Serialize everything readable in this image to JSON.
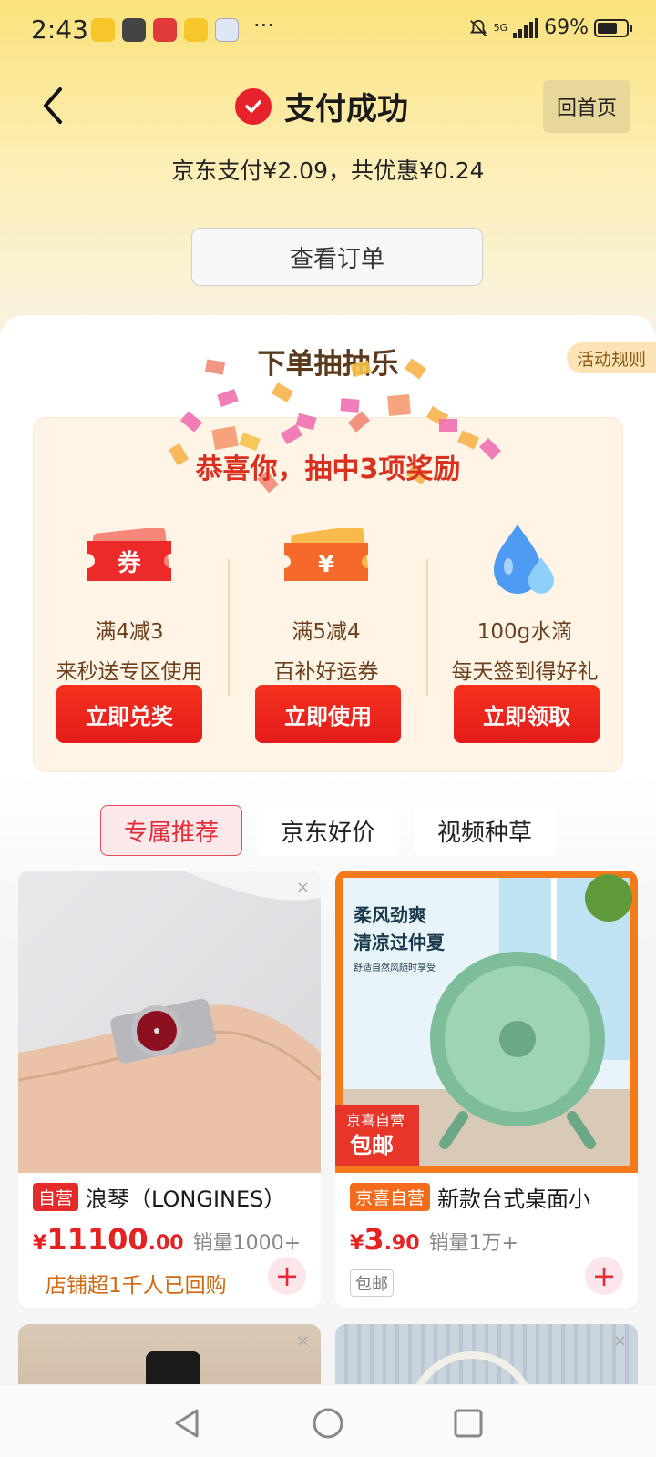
{
  "status_bar": {
    "time": "2:43",
    "more": "···",
    "battery": "69%",
    "network": "5G"
  },
  "header": {
    "title": "支付成功",
    "home_button": "回首页",
    "pay_summary": "京东支付¥2.09，共优惠¥0.24",
    "view_order_button": "查看订单"
  },
  "lottery": {
    "title": "下单抽抽乐",
    "rules": "活动规则",
    "congrats": "恭喜你，抽中3项奖励",
    "prizes": [
      {
        "line1": "满4减3",
        "line2": "来秒送专区使用",
        "button": "立即兑奖",
        "icon": "ticket-icon",
        "icon_text": "券"
      },
      {
        "line1": "满5减4",
        "line2": "百补好运券",
        "button": "立即使用",
        "icon": "coupon-yen-icon",
        "icon_text": "¥"
      },
      {
        "line1": "100g水滴",
        "line2": "每天签到得好礼",
        "button": "立即领取",
        "icon": "water-drop-icon"
      }
    ]
  },
  "tabs": [
    {
      "label": "专属推荐",
      "active": true
    },
    {
      "label": "京东好价",
      "active": false
    },
    {
      "label": "视频种草",
      "active": false
    }
  ],
  "products": [
    {
      "badge": "自营",
      "name": "浪琴（LONGINES）",
      "price_symbol": "¥",
      "price_int": "11100",
      "price_dec": ".00",
      "sales": "销量1000+",
      "promo": "店铺超1千人已回购"
    },
    {
      "badge": "京喜自营",
      "name": "新款台式桌面小",
      "price_symbol": "¥",
      "price_int": "3",
      "price_dec": ".90",
      "sales": "销量1万+",
      "promo": "包邮",
      "image_texts": {
        "headline1": "柔风劲爽",
        "headline2": "清凉过仲夏",
        "sub": "舒适自然风随时享受",
        "corner1": "京喜自营",
        "corner2": "包邮"
      }
    }
  ],
  "close_mark": "×",
  "add_mark": "+",
  "colors": {
    "accent_red": "#e52a2a",
    "header_yellow": "#fbe27c",
    "panel_bg": "#fff4e6"
  }
}
